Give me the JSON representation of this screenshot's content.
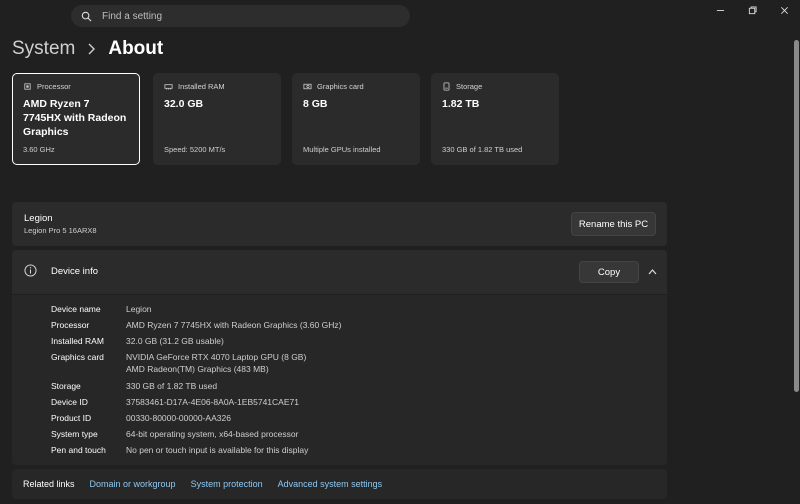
{
  "search": {
    "placeholder": "Find a setting"
  },
  "breadcrumb": {
    "parent": "System",
    "current": "About"
  },
  "cards": [
    {
      "title": "Processor",
      "value": "AMD Ryzen 7 7745HX with Radeon Graphics",
      "sub": "3.60 GHz",
      "icon": "cpu-icon"
    },
    {
      "title": "Installed RAM",
      "value": "32.0 GB",
      "sub": "Speed: 5200 MT/s",
      "icon": "ram-icon"
    },
    {
      "title": "Graphics card",
      "value": "8 GB",
      "sub": "Multiple GPUs installed",
      "icon": "gpu-icon"
    },
    {
      "title": "Storage",
      "value": "1.82 TB",
      "sub": "330 GB of 1.82 TB used",
      "icon": "storage-icon"
    }
  ],
  "pc": {
    "name": "Legion",
    "model": "Legion Pro 5 16ARX8",
    "rename_label": "Rename this PC"
  },
  "device_info": {
    "title": "Device info",
    "copy_label": "Copy",
    "rows": [
      {
        "label": "Device name",
        "value": "Legion"
      },
      {
        "label": "Processor",
        "value": "AMD Ryzen 7 7745HX with Radeon Graphics (3.60 GHz)"
      },
      {
        "label": "Installed RAM",
        "value": "32.0 GB (31.2 GB usable)"
      },
      {
        "label": "Graphics card",
        "value": "NVIDIA GeForce RTX 4070 Laptop GPU (8 GB)",
        "value2": "AMD Radeon(TM) Graphics (483 MB)"
      },
      {
        "label": "Storage",
        "value": "330 GB of 1.82 TB used"
      },
      {
        "label": "Device ID",
        "value": "37583461-D17A-4E06-8A0A-1EB5741CAE71"
      },
      {
        "label": "Product ID",
        "value": "00330-80000-00000-AA326"
      },
      {
        "label": "System type",
        "value": "64-bit operating system, x64-based processor"
      },
      {
        "label": "Pen and touch",
        "value": "No pen or touch input is available for this display"
      }
    ]
  },
  "related": {
    "label": "Related links",
    "links": [
      "Domain or workgroup",
      "System protection",
      "Advanced system settings"
    ]
  },
  "colors": {
    "background": "#202020",
    "card": "#2b2b2b",
    "link": "#8dc8f2"
  }
}
